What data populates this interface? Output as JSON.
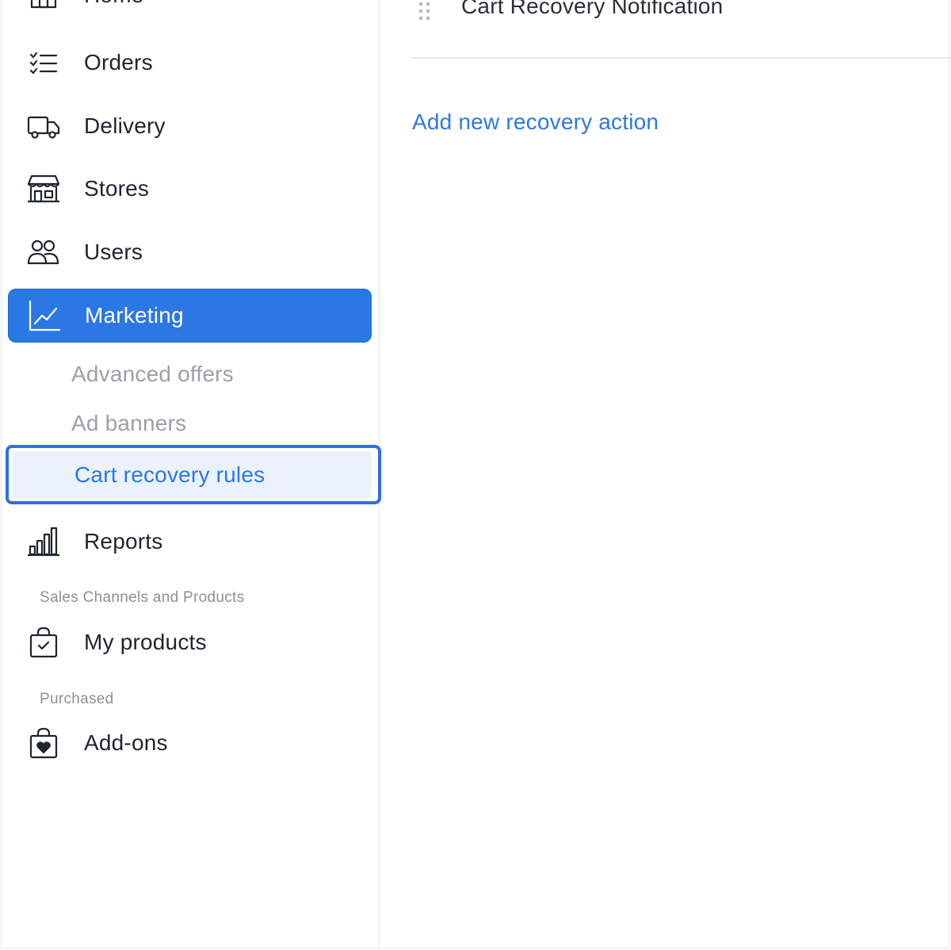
{
  "sidebar": {
    "items": [
      {
        "label": "Home",
        "icon": "home-icon"
      },
      {
        "label": "Orders",
        "icon": "list-check-icon"
      },
      {
        "label": "Delivery",
        "icon": "truck-icon"
      },
      {
        "label": "Stores",
        "icon": "storefront-icon"
      },
      {
        "label": "Users",
        "icon": "users-icon"
      },
      {
        "label": "Marketing",
        "icon": "line-chart-icon",
        "active": true
      },
      {
        "label": "Reports",
        "icon": "bar-chart-icon"
      }
    ],
    "marketing_sub": [
      {
        "label": "Advanced offers"
      },
      {
        "label": "Ad banners"
      },
      {
        "label": "Cart recovery rules",
        "selected": true
      }
    ],
    "sections": {
      "sales_channels": {
        "heading": "Sales Channels and Products",
        "items": [
          {
            "label": "My products",
            "icon": "shopping-bag-check-icon"
          }
        ]
      },
      "purchased": {
        "heading": "Purchased",
        "items": [
          {
            "label": "Add-ons",
            "icon": "shopping-bag-heart-icon"
          }
        ]
      }
    }
  },
  "main": {
    "title": "Cart Recovery Notification",
    "add_action_label": "Add new recovery action"
  },
  "colors": {
    "accent": "#2b78e4",
    "selected_bg": "#ebf2fd",
    "muted_text": "#9aa0a8"
  }
}
